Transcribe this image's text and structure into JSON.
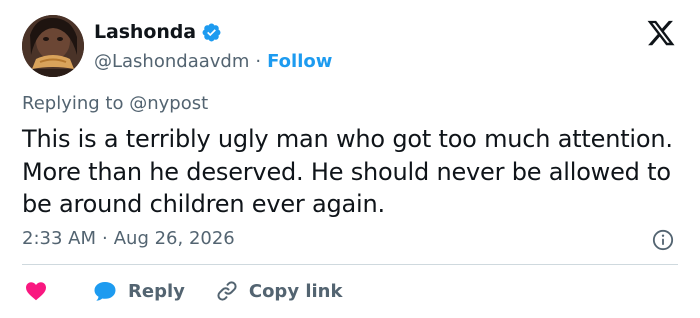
{
  "author": {
    "display_name": "Lashonda",
    "handle": "@Lashondaavdm",
    "separator": "·",
    "follow_label": "Follow",
    "verified": true,
    "avatar_icon": "profile-photo"
  },
  "reply_context": {
    "prefix": "Replying to ",
    "target": "@nypost"
  },
  "tweet": {
    "text": "This is a terribly ugly man who got too much attention. More than he deserved. He should never be allowed to be around children ever again.",
    "time": "2:33 AM",
    "separator": "·",
    "date": "Aug 26, 2026"
  },
  "actions": {
    "like_icon": "heart-icon",
    "reply_label": "Reply",
    "copy_label": "Copy link"
  },
  "colors": {
    "accent": "#1d9bf0",
    "like": "#f91880",
    "text": "#0f1419",
    "muted": "#536471",
    "divider": "#cfd9de"
  }
}
